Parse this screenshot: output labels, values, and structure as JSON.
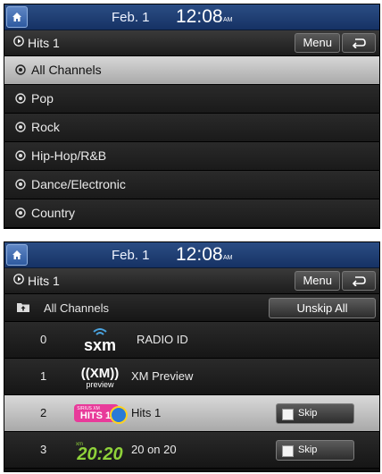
{
  "screens": [
    {
      "status": {
        "date": "Feb.  1",
        "time": "12:08",
        "ampm": "AM"
      },
      "title": {
        "name": "Hits 1",
        "menu_label": "Menu"
      },
      "channels": [
        {
          "label": "All Channels",
          "selected": true
        },
        {
          "label": "Pop",
          "selected": false
        },
        {
          "label": "Rock",
          "selected": false
        },
        {
          "label": "Hip-Hop/R&B",
          "selected": false
        },
        {
          "label": "Dance/Electronic",
          "selected": false
        },
        {
          "label": "Country",
          "selected": false
        }
      ]
    },
    {
      "status": {
        "date": "Feb.  1",
        "time": "12:08",
        "ampm": "AM"
      },
      "title": {
        "name": "Hits 1",
        "menu_label": "Menu"
      },
      "category": {
        "label": "All Channels",
        "unskip_label": "Unskip All"
      },
      "channel_list": [
        {
          "number": "0",
          "logo": "sxm",
          "logo_text": "sxm",
          "name": "RADIO ID",
          "skip": false,
          "selected": false
        },
        {
          "number": "1",
          "logo": "xm-preview",
          "logo_text": "((XM))",
          "logo_sub": "preview",
          "name": "XM Preview",
          "skip": false,
          "selected": false
        },
        {
          "number": "2",
          "logo": "hits1",
          "logo_text": "HITS 1",
          "logo_sub": "SIRIUS XM",
          "name": "Hits 1",
          "skip_label": "Skip",
          "skip": true,
          "selected": true
        },
        {
          "number": "3",
          "logo": "20on20",
          "logo_text": "20:20",
          "logo_sub": "xm",
          "name": "20 on 20",
          "skip_label": "Skip",
          "skip": true,
          "selected": false
        }
      ]
    }
  ],
  "colors": {
    "topbar": "#1e3d72",
    "selected_row": "#c4c4c4",
    "row": "#1f1f1f",
    "hits_pink": "#e83a9a",
    "twenty_green": "#8fd23a"
  }
}
